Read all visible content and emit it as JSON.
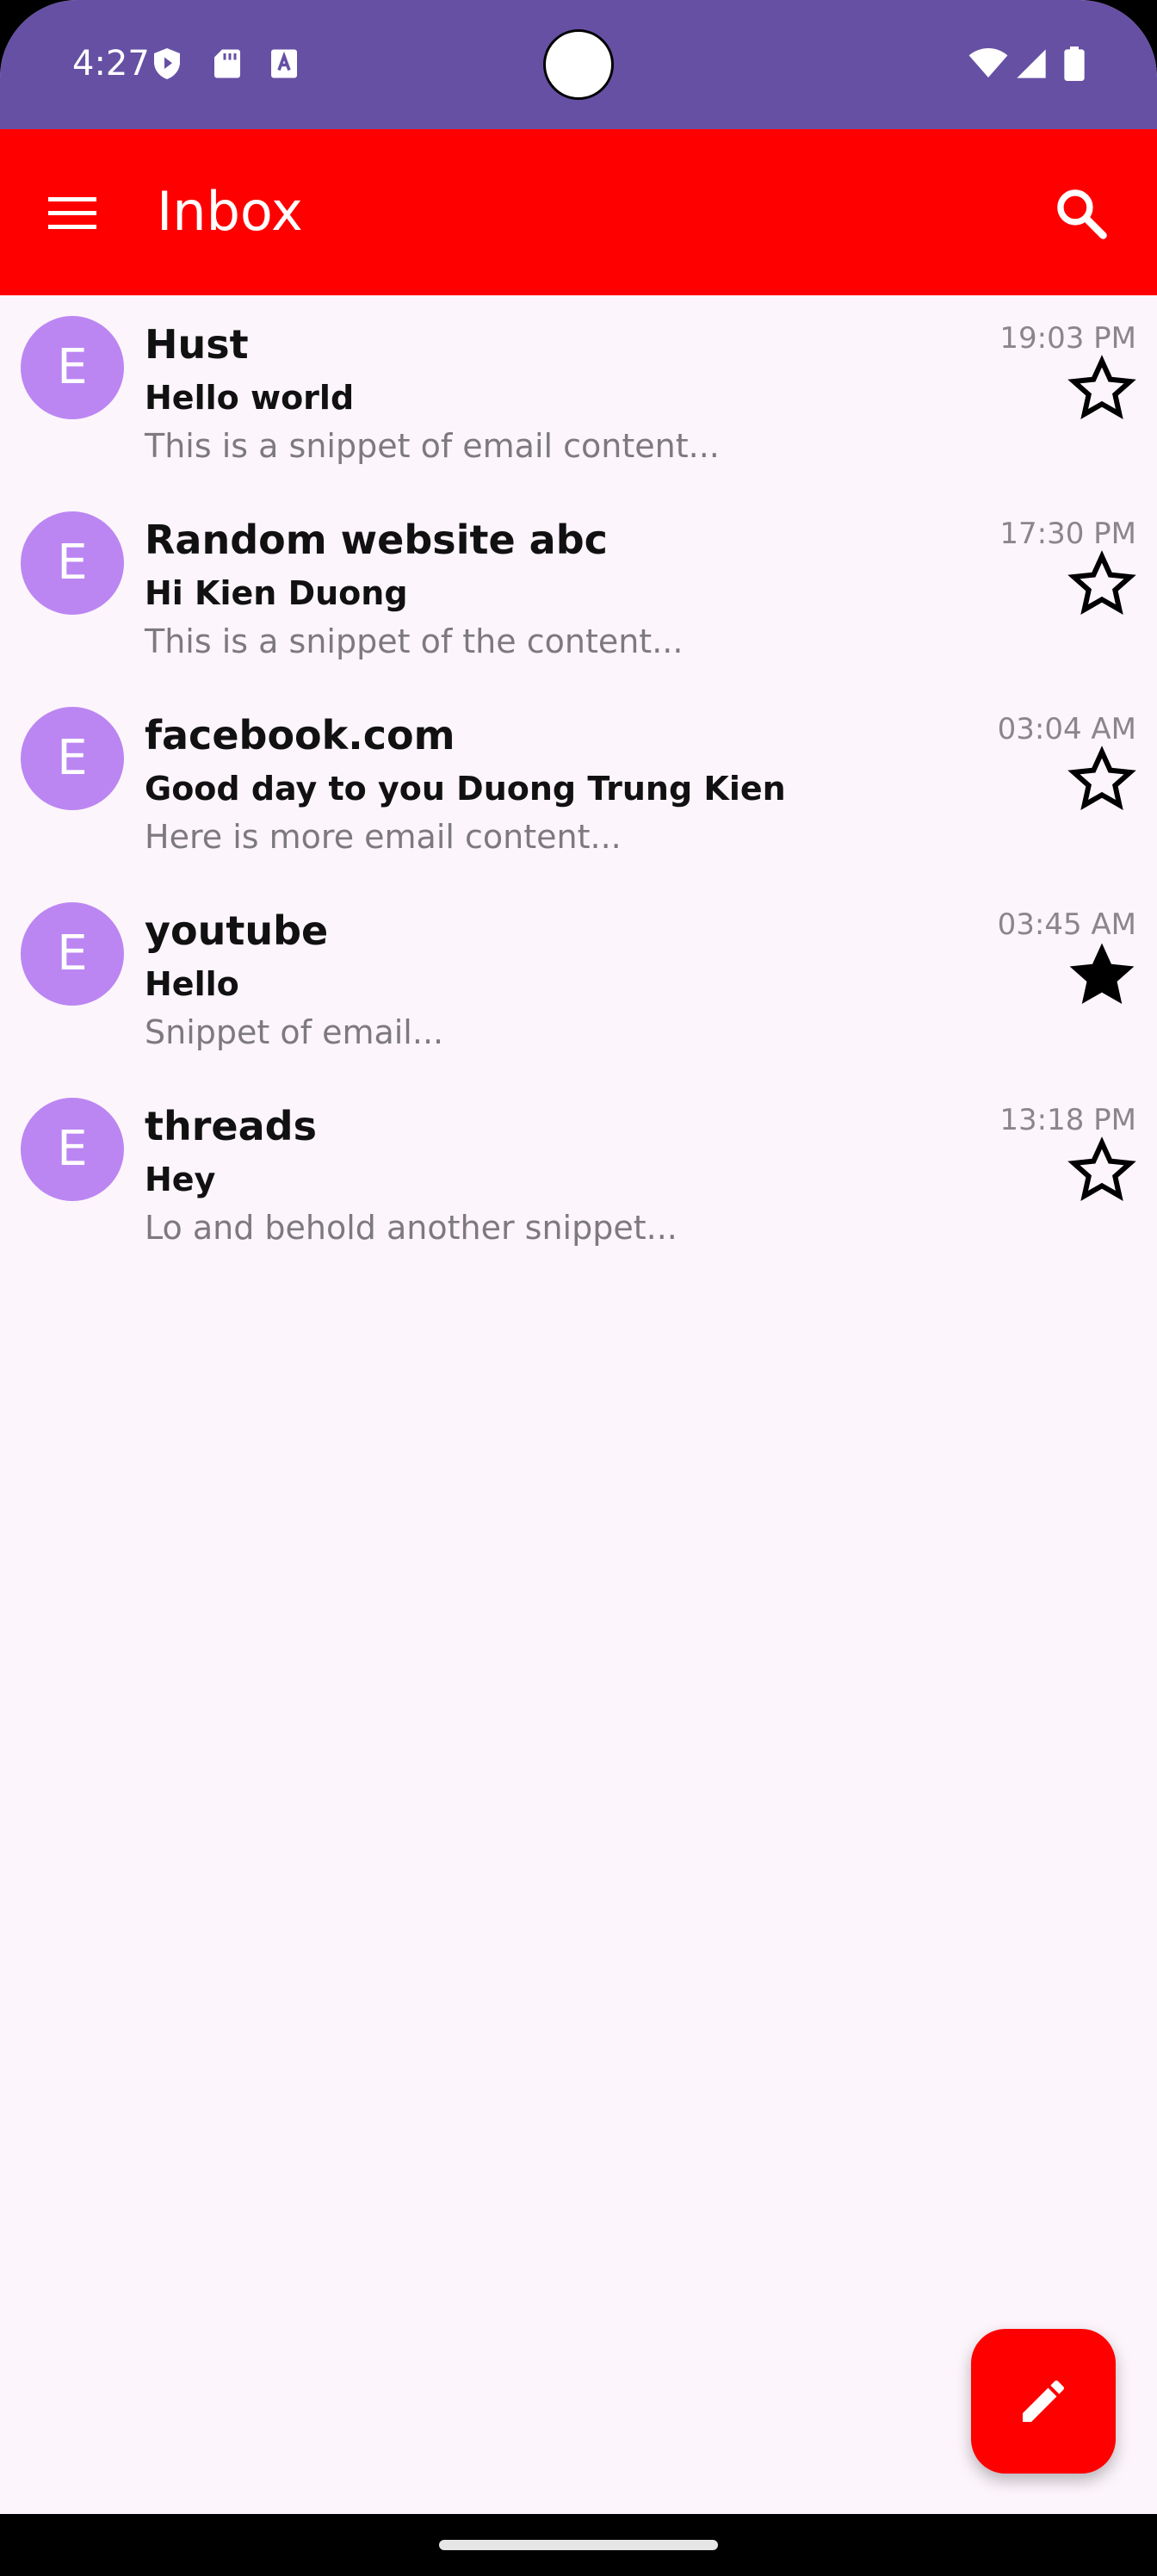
{
  "status_bar": {
    "time": "4:27",
    "background": "#6650a4",
    "left_icons": [
      "shield-play-icon",
      "sd-card-icon",
      "font-a-icon"
    ],
    "right_icons": [
      "wifi-icon",
      "cellular-signal-icon",
      "battery-icon"
    ]
  },
  "app_bar": {
    "title": "Inbox",
    "background": "#ff0000",
    "menu_icon": "hamburger-menu-icon",
    "search_icon": "search-icon"
  },
  "emails": [
    {
      "avatar_letter": "E",
      "sender": "Hust",
      "subject": "Hello world",
      "snippet": "This is a snippet of email content...",
      "time": "19:03 PM",
      "starred": false
    },
    {
      "avatar_letter": "E",
      "sender": "Random website abc",
      "subject": "Hi Kien Duong",
      "snippet": "This is a snippet of the content...",
      "time": "17:30 PM",
      "starred": false
    },
    {
      "avatar_letter": "E",
      "sender": "facebook.com",
      "subject": "Good day to you Duong Trung Kien",
      "snippet": "Here is more email content...",
      "time": "03:04 AM",
      "starred": false
    },
    {
      "avatar_letter": "E",
      "sender": "youtube",
      "subject": "Hello",
      "snippet": "Snippet of email...",
      "time": "03:45 AM",
      "starred": true
    },
    {
      "avatar_letter": "E",
      "sender": "threads",
      "subject": "Hey",
      "snippet": "Lo and behold another snippet...",
      "time": "13:18 PM",
      "starred": false
    }
  ],
  "fab": {
    "icon": "pencil-icon",
    "background": "#ff0000"
  },
  "colors": {
    "avatar": "#bb86f2",
    "list_background": "#fdf5fc",
    "snippet_text": "#7d7a7f"
  }
}
